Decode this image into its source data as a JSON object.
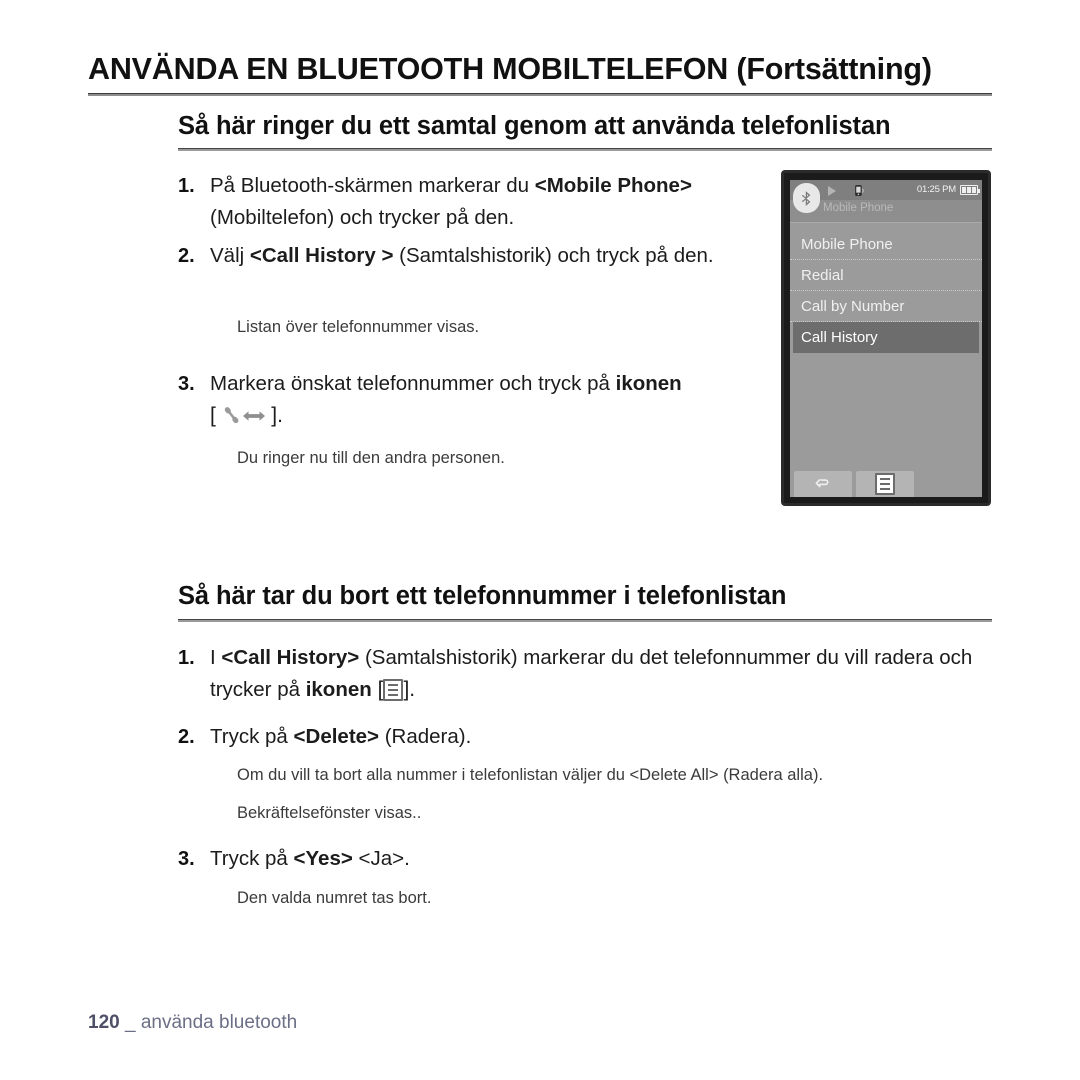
{
  "document": {
    "chapter_title": "ANVÄNDA EN BLUETOOTH MOBILTELEFON (Fortsättning)",
    "footer": {
      "page_number": "120",
      "separator": "_",
      "chapter_label": "använda bluetooth"
    }
  },
  "section1": {
    "heading": "Så här ringer du ett samtal genom att använda telefonlistan",
    "steps": [
      {
        "number": "1.",
        "text_a": "På Bluetooth-skärmen markerar du ",
        "bold_a": "<Mobile Phone>",
        "text_b": " (Mobiltelefon) och trycker på den."
      },
      {
        "number": "2.",
        "text_a": "Välj ",
        "bold_a": "<Call History >",
        "text_b": " (Samtalshistorik) och tryck på den.",
        "note": "Listan över telefonnummer visas."
      },
      {
        "number": "3.",
        "text_a": "Markera önskat telefonnummer och tryck på ",
        "bold_a": "ikonen",
        "icon": "call-phone-icon",
        "bracket_open": "[",
        "bracket_close": "].",
        "note": "Du ringer nu till den andra personen."
      }
    ]
  },
  "section2": {
    "heading": "Så här tar du bort ett telefonnummer i telefonlistan",
    "steps": [
      {
        "number": "1.",
        "text_a": "I ",
        "bold_a": "<Call History>",
        "text_b": " (Samtalshistorik) markerar du det telefonnummer du vill radera och trycker på ",
        "bold_b": "ikonen",
        "icon": "menu-list-icon",
        "bracket_open": " [",
        "bracket_close": "]."
      },
      {
        "number": "2.",
        "text_a": "Tryck på ",
        "bold_a": "<Delete>",
        "text_b": " (Radera).",
        "note1": "Om du vill ta bort alla nummer i telefonlistan väljer du <Delete All> (Radera alla).",
        "note2": "Bekräftelsefönster visas.."
      },
      {
        "number": "3.",
        "text_a": "Tryck på ",
        "bold_a": "<Yes>",
        "text_b": " <Ja>.",
        "note": "Den valda numret tas bort."
      }
    ]
  },
  "device": {
    "status_bar": {
      "bluetooth_icon": "bluetooth-icon",
      "play_icon": "play-icon",
      "phone_icon": "phone-status-icon",
      "time": "01:25 PM",
      "battery_icon": "battery-full-icon"
    },
    "screen_title": "Mobile Phone",
    "menu_items": [
      {
        "label": "Mobile Phone",
        "selected": false
      },
      {
        "label": "Redial",
        "selected": false
      },
      {
        "label": "Call by Number",
        "selected": false
      },
      {
        "label": "Call History",
        "selected": true
      }
    ],
    "softkeys": [
      {
        "icon": "back-arrow-icon"
      },
      {
        "icon": "menu-list-icon"
      }
    ]
  },
  "colors": {
    "text": "#1a1a1a",
    "footer": "#6b6f86",
    "rule": "#8d8d8d",
    "device_frame": "#1b1b1b",
    "device_screen": "#9b9b9b",
    "selected_row": "#6d6d6d"
  }
}
